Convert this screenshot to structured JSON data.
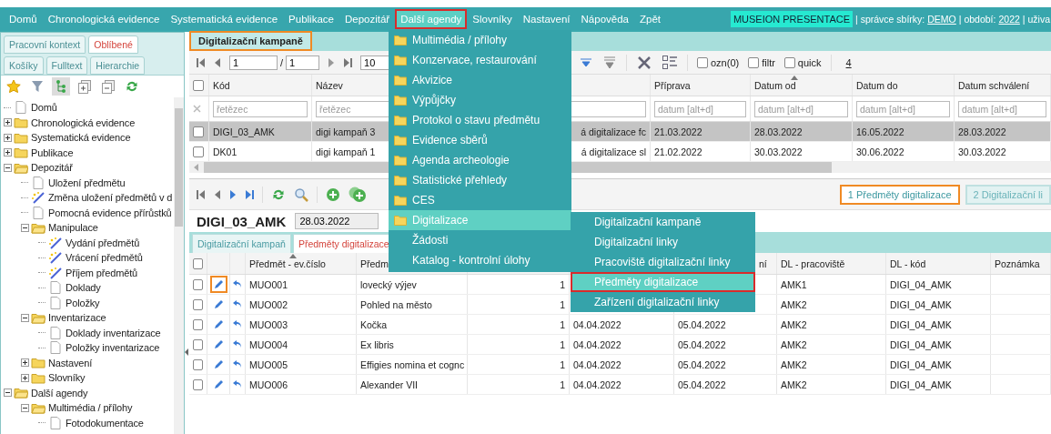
{
  "nav": {
    "items": [
      {
        "label": "Domů",
        "selected": false
      },
      {
        "label": "Chronologická evidence",
        "selected": false
      },
      {
        "label": "Systematická evidence",
        "selected": false
      },
      {
        "label": "Publikace",
        "selected": false
      },
      {
        "label": "Depozitář",
        "selected": false
      },
      {
        "label": "Další agendy",
        "selected": true,
        "outlined": true
      },
      {
        "label": "Slovníky",
        "selected": false
      },
      {
        "label": "Nastavení",
        "selected": false
      },
      {
        "label": "Nápověda",
        "selected": false
      },
      {
        "label": "Zpět",
        "selected": false
      }
    ],
    "status": {
      "badge": "MUSEION PRESENTACE",
      "segments": [
        {
          "text": "| správce sbírky:",
          "link": false
        },
        {
          "text": "DEMO",
          "link": true
        },
        {
          "text": "| období:",
          "link": false
        },
        {
          "text": "2022",
          "link": true
        },
        {
          "text": "| uživa",
          "link": false
        }
      ]
    }
  },
  "sidebar": {
    "tab_rows": [
      {
        "tabs": [
          {
            "label": "Pracovní kontext",
            "selected": false
          },
          {
            "label": "Oblíbené",
            "selected": true
          }
        ]
      },
      {
        "tabs": [
          {
            "label": "Košíky",
            "selected": false
          },
          {
            "label": "Fulltext",
            "selected": false
          },
          {
            "label": "Hierarchie",
            "selected": false
          }
        ]
      }
    ],
    "tools": [
      {
        "kind": "star",
        "pressed": false
      },
      {
        "kind": "filter",
        "pressed": false
      },
      {
        "kind": "tree",
        "pressed": true
      },
      {
        "kind": "expand",
        "pressed": false
      },
      {
        "kind": "collapse",
        "pressed": false
      },
      {
        "kind": "refresh",
        "pressed": false
      }
    ],
    "tree": [
      {
        "label": "Domů",
        "kind": "page"
      },
      {
        "label": "Chronologická evidence",
        "kind": "folder",
        "expanded": false
      },
      {
        "label": "Systematická evidence",
        "kind": "folder",
        "expanded": false
      },
      {
        "label": "Publikace",
        "kind": "folder",
        "expanded": false
      },
      {
        "label": "Depozitář",
        "kind": "folder",
        "expanded": true,
        "children": [
          {
            "label": "Uložení předmětu",
            "kind": "page"
          },
          {
            "label": "Změna uložení předmětů v d",
            "kind": "tool"
          },
          {
            "label": "Pomocná evidence přírůstků",
            "kind": "page"
          },
          {
            "label": "Manipulace",
            "kind": "folder",
            "expanded": true,
            "children": [
              {
                "label": "Vydání předmětů",
                "kind": "tool"
              },
              {
                "label": "Vrácení předmětů",
                "kind": "tool"
              },
              {
                "label": "Příjem předmětů",
                "kind": "tool"
              },
              {
                "label": "Doklady",
                "kind": "page"
              },
              {
                "label": "Položky",
                "kind": "page"
              }
            ]
          },
          {
            "label": "Inventarizace",
            "kind": "folder",
            "expanded": true,
            "children": [
              {
                "label": "Doklady inventarizace",
                "kind": "page"
              },
              {
                "label": "Položky inventarizace",
                "kind": "page"
              }
            ]
          },
          {
            "label": "Nastavení",
            "kind": "folder",
            "expanded": false
          },
          {
            "label": "Slovníky",
            "kind": "folder",
            "expanded": false
          }
        ]
      },
      {
        "label": "Další agendy",
        "kind": "folder",
        "expanded": true,
        "children": [
          {
            "label": "Multimédia / přílohy",
            "kind": "folder",
            "expanded": true,
            "children": [
              {
                "label": "Fotodokumentace",
                "kind": "page"
              }
            ]
          }
        ]
      }
    ]
  },
  "campaigns": {
    "title": "Digitalizační kampaně",
    "title_outlined": true,
    "pager": {
      "page": "1",
      "separator": "/",
      "pages": "1",
      "page_size": "10"
    },
    "options": [
      {
        "label": "ozn(0)",
        "checked": false
      },
      {
        "label": "filtr",
        "checked": false
      },
      {
        "label": "quick",
        "checked": false
      }
    ],
    "count": "4",
    "select_all": {
      "checked": false
    },
    "columns": [
      {
        "label": "Kód",
        "sorted": false
      },
      {
        "label": "Název",
        "sorted": false
      },
      {},
      {
        "label": "Příprava",
        "sorted": false
      },
      {
        "label": "Datum od",
        "sorted": true
      },
      {
        "label": "Datum do",
        "sorted": false
      },
      {
        "label": "Datum schválení",
        "sorted": false
      }
    ],
    "filters": [
      {
        "kind": "text",
        "placeholder": "řetězec"
      },
      {
        "kind": "text",
        "placeholder": "řetězec"
      },
      {
        "kind": "blank"
      },
      {
        "kind": "date",
        "placeholder": "datum [alt+d]"
      },
      {
        "kind": "date",
        "placeholder": "datum [alt+d]"
      },
      {
        "kind": "date",
        "placeholder": "datum [alt+d]"
      },
      {
        "kind": "date",
        "placeholder": "datum [alt+d]"
      }
    ],
    "rows": [
      {
        "selected": true,
        "checked": false,
        "cells": [
          "DIGI_03_AMK",
          "digi kampaň 3",
          "á digitalizace fc",
          "21.03.2022",
          "28.03.2022",
          "16.05.2022",
          "28.03.2022"
        ]
      },
      {
        "selected": false,
        "checked": false,
        "cells": [
          "DK01",
          "digi kampaň 1",
          "á digitalizace sl",
          "21.02.2022",
          "30.03.2022",
          "30.06.2022",
          "30.03.2022"
        ]
      }
    ]
  },
  "detail": {
    "side_tabs": [
      {
        "label": "1 Předměty digitalizace",
        "selected": true,
        "outlined": true
      },
      {
        "label": "2 Digitalizační li",
        "selected": false
      }
    ],
    "record": {
      "code": "DIGI_03_AMK",
      "date": "28.03.2022"
    },
    "tabs": [
      {
        "label": "Digitalizační kampaň",
        "selected": false
      },
      {
        "label": "Předměty digitalizace",
        "selected": true
      }
    ],
    "select_all": {
      "checked": false
    },
    "columns": [
      {
        "label": "Předmět - ev.číslo",
        "sorted": true
      },
      {
        "label": "Předm",
        "sorted": false
      },
      {},
      {},
      {
        "label": "ní",
        "sorted": false
      },
      {
        "label": "DL - pracoviště",
        "sorted": false
      },
      {
        "label": "DL - kód",
        "sorted": false
      },
      {
        "label": "Poznámka",
        "sorted": false
      }
    ],
    "rows": [
      {
        "checked": false,
        "edit_outlined": true,
        "cells": [
          "MUO001",
          "lovecký výjev",
          "1",
          null,
          null,
          "AMK1",
          "DIGI_04_AMK",
          null
        ]
      },
      {
        "checked": false,
        "cells": [
          "MUO002",
          "Pohled na město",
          "1",
          null,
          null,
          "AMK2",
          "DIGI_04_AMK",
          null
        ]
      },
      {
        "checked": false,
        "cells": [
          "MUO003",
          "Kočka",
          "1",
          "04.04.2022",
          "05.04.2022",
          "AMK2",
          "DIGI_04_AMK",
          null
        ]
      },
      {
        "checked": false,
        "cells": [
          "MUO004",
          "Ex libris",
          "1",
          "04.04.2022",
          "05.04.2022",
          "AMK2",
          "DIGI_04_AMK",
          null
        ]
      },
      {
        "checked": false,
        "cells": [
          "MUO005",
          "Effigies nomina et cognc",
          "1",
          "04.04.2022",
          "05.04.2022",
          "AMK2",
          "DIGI_04_AMK",
          null
        ]
      },
      {
        "checked": false,
        "cells": [
          "MUO006",
          "Alexander VII",
          "1",
          "04.04.2022",
          "05.04.2022",
          "AMK2",
          "DIGI_04_AMK",
          null
        ]
      }
    ]
  },
  "menu": {
    "items": [
      {
        "label": "Multimédia / přílohy",
        "kind": "folder",
        "selected": false
      },
      {
        "label": "Konzervace, restaurování",
        "kind": "folder",
        "selected": false
      },
      {
        "label": "Akvizice",
        "kind": "folder",
        "selected": false
      },
      {
        "label": "Výpůjčky",
        "kind": "folder",
        "selected": false
      },
      {
        "label": "Protokol o stavu předmětu",
        "kind": "folder",
        "selected": false
      },
      {
        "label": "Evidence sběrů",
        "kind": "folder",
        "selected": false
      },
      {
        "label": "Agenda archeologie",
        "kind": "folder",
        "selected": false
      },
      {
        "label": "Statistické přehledy",
        "kind": "folder",
        "selected": false
      },
      {
        "label": "CES",
        "kind": "folder",
        "selected": false
      },
      {
        "label": "Digitalizace",
        "kind": "folder",
        "selected": true
      },
      {
        "label": "Žádosti",
        "kind": "plain",
        "selected": false
      },
      {
        "label": "Katalog - kontrolní úlohy",
        "kind": "plain",
        "selected": false
      }
    ],
    "submenu": [
      {
        "label": "Digitalizační kampaně",
        "selected": false
      },
      {
        "label": "Digitalizační linky",
        "selected": false
      },
      {
        "label": "Pracoviště digitalizační linky",
        "selected": false
      },
      {
        "label": "Předměty digitalizace",
        "selected": true,
        "outlined": true
      },
      {
        "label": "Zařízení digitalizační linky",
        "selected": false
      }
    ]
  }
}
